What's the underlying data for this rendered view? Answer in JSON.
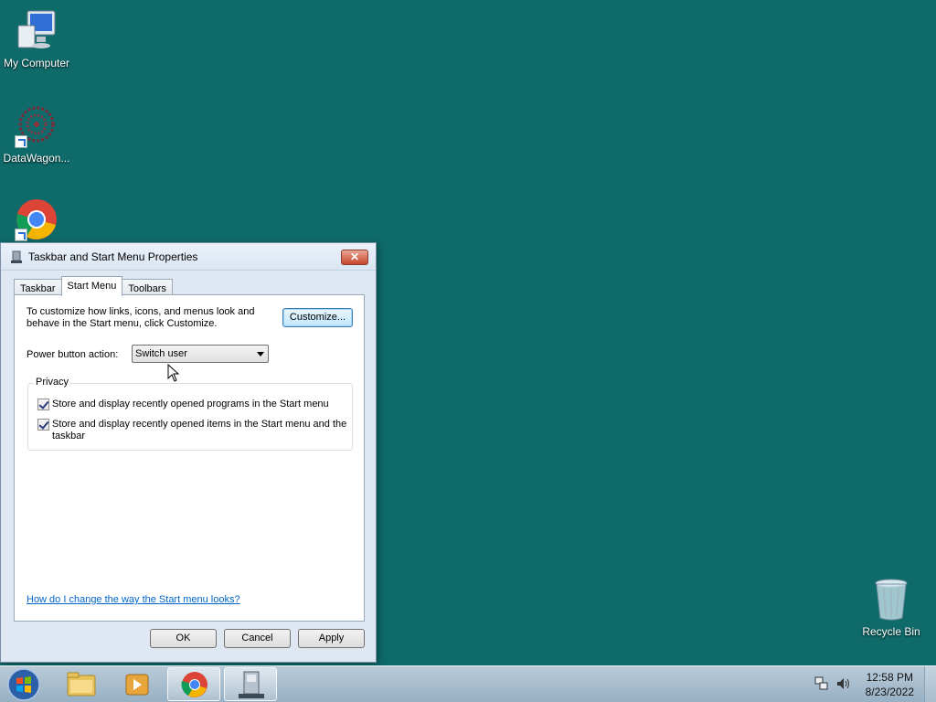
{
  "desktop": {
    "icons": [
      {
        "label": "My Computer"
      },
      {
        "label": "DataWagon..."
      },
      {
        "label": ""
      }
    ],
    "recycle_bin": {
      "label": "Recycle Bin"
    }
  },
  "dialog": {
    "title": "Taskbar and Start Menu Properties",
    "close_label": "✕",
    "tabs": [
      {
        "label": "Taskbar"
      },
      {
        "label": "Start Menu"
      },
      {
        "label": "Toolbars"
      }
    ],
    "active_tab": "Start Menu",
    "intro_text": "To customize how links, icons, and menus look and behave in the Start menu, click Customize.",
    "customize_label": "Customize...",
    "power_label": "Power button action:",
    "power_value": "Switch user",
    "privacy": {
      "label": "Privacy",
      "options": [
        {
          "label": "Store and display recently opened programs in the Start menu",
          "checked": true
        },
        {
          "label": "Store and display recently opened items in the Start menu and the taskbar",
          "checked": true
        }
      ]
    },
    "help_link": "How do I change the way the Start menu looks?",
    "buttons": {
      "ok": "OK",
      "cancel": "Cancel",
      "apply": "Apply"
    }
  },
  "taskbar": {
    "clock": {
      "time": "12:58 PM",
      "date": "8/23/2022"
    },
    "items": [
      "start-orb",
      "file-explorer",
      "media-player",
      "chrome",
      "taskbar-properties"
    ]
  },
  "colors": {
    "desktop": "#0f6a6a",
    "accent_link": "#0066cc",
    "close_button": "#c7452c"
  }
}
